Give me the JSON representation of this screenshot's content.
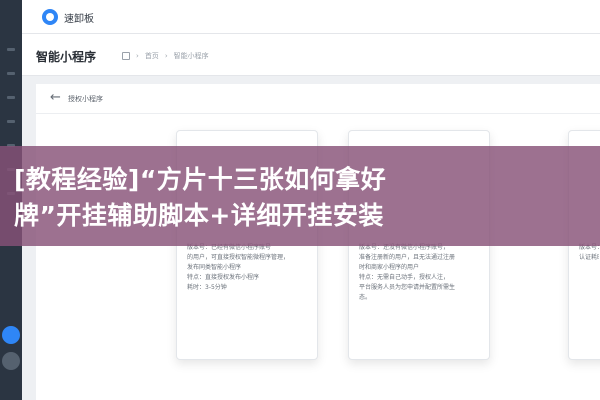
{
  "header": {
    "brand": "速卸板"
  },
  "breadcrumb_bar": {
    "page_title": "智能小程序",
    "crumbs": [
      "首页",
      "智能小程序"
    ]
  },
  "card": {
    "title": "授权小程序"
  },
  "panels": [
    {
      "lines": [
        "版本号：已经有微信小程序账号",
        "的用户，可直接授权智能微程序管理，",
        "发布同类智能小程序",
        "特点：直接授权发布小程序",
        "耗时：3-5分钟"
      ]
    },
    {
      "lines": [
        "版本号：还没有微信小程序账号，",
        "准备注册新的用户，且无法通过注册",
        "时和商家小程序的用户",
        "特点：无需自己动手，授权人注，",
        "平台服务人员为您申请并配置所需生",
        "态。"
      ]
    },
    {
      "lines": [
        "版本号：",
        "认证耗时："
      ]
    }
  ],
  "banner": {
    "line1": "[教程经验]“方片十三张如何拿好",
    "line2": "牌”开挂辅助脚本+详细开挂安装"
  }
}
